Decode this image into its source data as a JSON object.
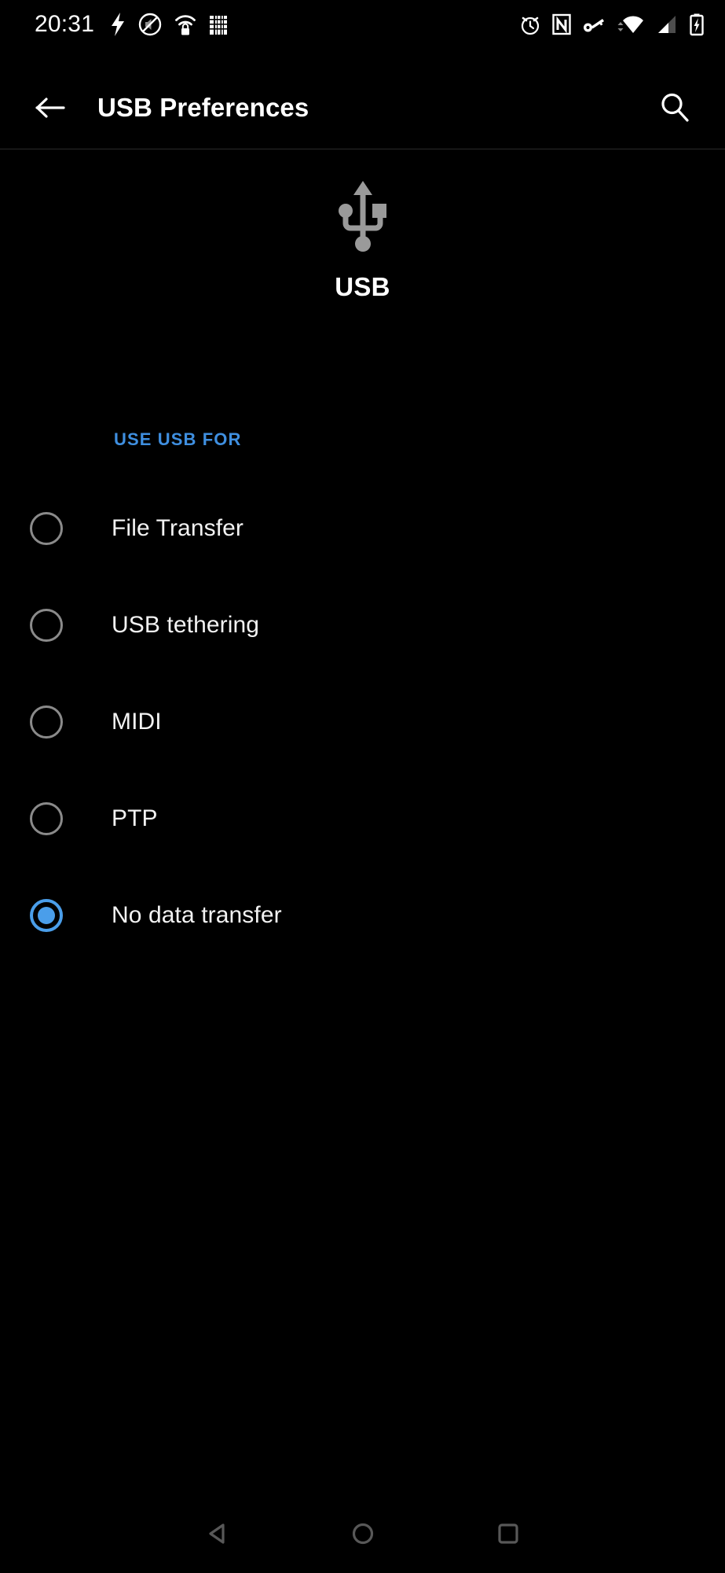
{
  "colors": {
    "background": "#000000",
    "accent_blue": "#4a9eea",
    "section_label_blue": "#3f8fe0",
    "text_primary": "#ffffff",
    "text_secondary": "#f2f2f2",
    "radio_unselected": "#8a8a8a",
    "usb_logo_gray": "#9a9a9a",
    "divider": "#2a2a2a",
    "nav_icon": "#555555"
  },
  "status_bar": {
    "clock": "20:31",
    "left_icons": [
      "charging-bolt-icon",
      "sound-off-icon",
      "wifi-lock-icon",
      "sim-toolkit-icon"
    ],
    "right_icons": [
      "alarm-clock-icon",
      "nfc-icon",
      "vpn-key-icon",
      "wifi-data-activity-icon",
      "cellular-signal-icon",
      "battery-charging-icon"
    ]
  },
  "app_bar": {
    "back_icon": "arrow-left-icon",
    "title": "USB Preferences",
    "search_icon": "search-icon"
  },
  "header": {
    "icon": "usb-trident-icon",
    "title": "USB"
  },
  "section": {
    "label": "USE USB FOR"
  },
  "options": [
    {
      "label": "File Transfer",
      "selected": false
    },
    {
      "label": "USB tethering",
      "selected": false
    },
    {
      "label": "MIDI",
      "selected": false
    },
    {
      "label": "PTP",
      "selected": false
    },
    {
      "label": "No data transfer",
      "selected": true
    }
  ],
  "nav_bar": {
    "back_label": "Back",
    "home_label": "Home",
    "recents_label": "Recents",
    "icons": [
      "nav-back-triangle-icon",
      "nav-home-circle-icon",
      "nav-recents-square-icon"
    ]
  }
}
